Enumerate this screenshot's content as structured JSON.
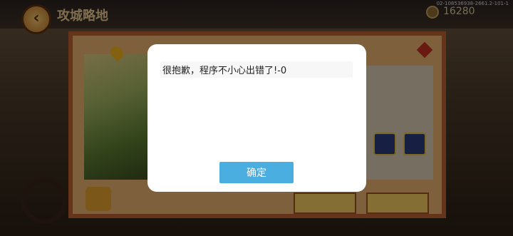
{
  "game": {
    "title": "攻城略地",
    "build_id": "02-108536938-2661.2-101-1",
    "coins": "16280",
    "back_icon": "back-arrow-icon",
    "coin_icon": "coin-icon"
  },
  "dialog": {
    "message": "很抱歉，程序不小心出错了!-0",
    "confirm_label": "确定"
  },
  "colors": {
    "confirm_button": "#4aaee0",
    "dialog_bg": "#ffffff",
    "overlay": "rgba(0,0,0,0.45)"
  }
}
